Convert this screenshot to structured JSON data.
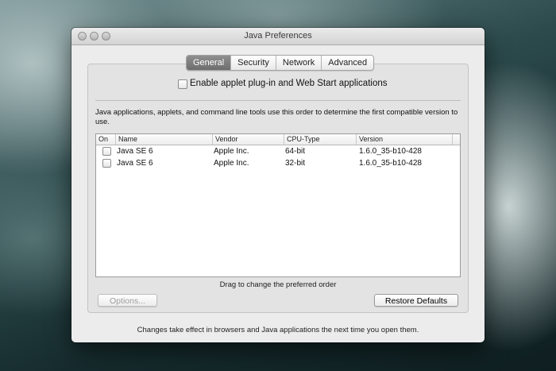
{
  "window": {
    "title": "Java Preferences"
  },
  "tabs": [
    {
      "label": "General",
      "selected": true
    },
    {
      "label": "Security",
      "selected": false
    },
    {
      "label": "Network",
      "selected": false
    },
    {
      "label": "Advanced",
      "selected": false
    }
  ],
  "general": {
    "enable_applet_label": "Enable applet plug-in and Web Start applications",
    "enable_applet_checked": false,
    "description": "Java applications, applets, and command line tools use this order to determine the first compatible version to use.",
    "table": {
      "columns": [
        "On",
        "Name",
        "Vendor",
        "CPU-Type",
        "Version"
      ],
      "rows": [
        {
          "on": false,
          "name": "Java SE 6",
          "vendor": "Apple Inc.",
          "cpu": "64-bit",
          "version": "1.6.0_35-b10-428"
        },
        {
          "on": false,
          "name": "Java SE 6",
          "vendor": "Apple Inc.",
          "cpu": "32-bit",
          "version": "1.6.0_35-b10-428"
        }
      ]
    },
    "drag_hint": "Drag to change the preferred order",
    "options_button": "Options...",
    "restore_button": "Restore Defaults"
  },
  "footer_note": "Changes take effect in browsers and Java applications the next time you open them."
}
